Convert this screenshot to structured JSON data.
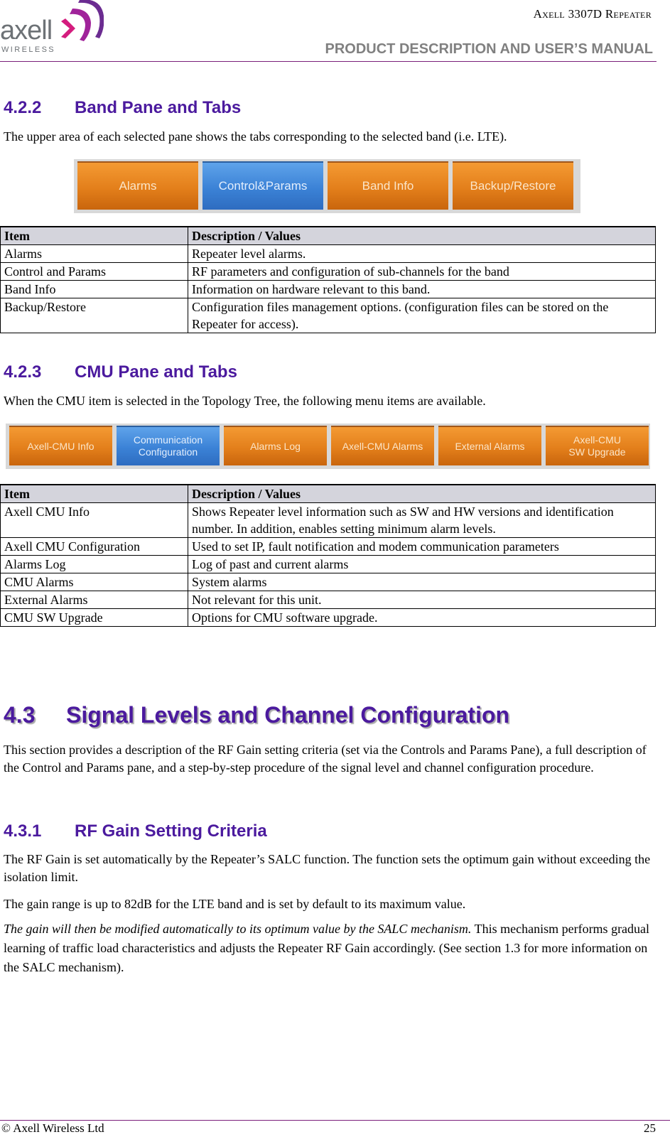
{
  "header": {
    "logo_text": "axell",
    "logo_subtext": "WIRELESS",
    "product": "Axell 3307D Repeater",
    "manual": "PRODUCT DESCRIPTION AND USER’S MANUAL"
  },
  "section_422": {
    "number": "4.2.2",
    "title": "Band Pane and Tabs",
    "intro": "The upper area of each selected pane shows the tabs corresponding to the selected band (i.e. LTE).",
    "tabs": [
      {
        "label": "Alarms",
        "active": false
      },
      {
        "label": "Control&Params",
        "active": true
      },
      {
        "label": "Band Info",
        "active": false
      },
      {
        "label": "Backup/Restore",
        "active": false
      }
    ],
    "table": {
      "headers": [
        "Item",
        "Description / Values"
      ],
      "rows": [
        [
          "Alarms",
          "Repeater level alarms."
        ],
        [
          "Control and Params",
          "RF parameters and configuration of sub-channels for the band"
        ],
        [
          "Band Info",
          "Information on hardware relevant to this band."
        ],
        [
          "Backup/Restore",
          "Configuration files management options. (configuration files can be stored on the Repeater for access)."
        ]
      ]
    }
  },
  "section_423": {
    "number": "4.2.3",
    "title": "CMU Pane and Tabs",
    "intro": "When the CMU item is selected in the Topology Tree, the following menu items are available.",
    "tabs": [
      {
        "line1": "Axell-CMU Info",
        "line2": "",
        "active": false
      },
      {
        "line1": "Communication",
        "line2": "Configuration",
        "active": true
      },
      {
        "line1": "Alarms Log",
        "line2": "",
        "active": false
      },
      {
        "line1": "Axell-CMU Alarms",
        "line2": "",
        "active": false
      },
      {
        "line1": "External Alarms",
        "line2": "",
        "active": false
      },
      {
        "line1": "Axell-CMU",
        "line2": "SW Upgrade",
        "active": false
      }
    ],
    "table": {
      "headers": [
        "Item",
        "Description / Values"
      ],
      "rows": [
        [
          "Axell CMU Info",
          "Shows Repeater level information such as SW and HW versions and identification number. In addition, enables setting minimum alarm levels."
        ],
        [
          "Axell CMU Configuration",
          "Used to set IP, fault notification and modem communication parameters"
        ],
        [
          "Alarms Log",
          "Log of past and current alarms"
        ],
        [
          "CMU Alarms",
          "System alarms"
        ],
        [
          "External Alarms",
          "Not relevant for this unit."
        ],
        [
          "CMU SW Upgrade",
          "Options for CMU software upgrade."
        ]
      ]
    }
  },
  "section_43": {
    "number": "4.3",
    "title": "Signal Levels and Channel Configuration",
    "intro": "This section provides a description of the RF Gain setting criteria (set via the Controls and Params Pane), a full description of the Control and Params pane, and a step-by-step procedure of the signal level and channel configuration procedure."
  },
  "section_431": {
    "number": "4.3.1",
    "title": "RF Gain Setting Criteria",
    "para1": "The RF Gain is set automatically by the Repeater’s SALC function. The function sets the optimum gain without exceeding the isolation limit.",
    "para2": "The gain range is up to 82dB for the LTE band and is set by default to its maximum value.",
    "para3_italic": "The gain will then be modified automatically to its optimum value by the SALC mechanism.",
    "para3_rest": " This mechanism performs gradual learning of traffic load characteristics and adjusts the Repeater RF Gain accordingly. (See section 1.3 for more information on the SALC mechanism)."
  },
  "footer": {
    "copyright": "© Axell Wireless Ltd",
    "page": "25"
  },
  "colors": {
    "heading": "#4b1a9e",
    "rule": "#7a1e7a",
    "tab_orange": "#e37f1b",
    "tab_blue": "#3b82d6",
    "table_header_bg": "#d4d4dc"
  }
}
